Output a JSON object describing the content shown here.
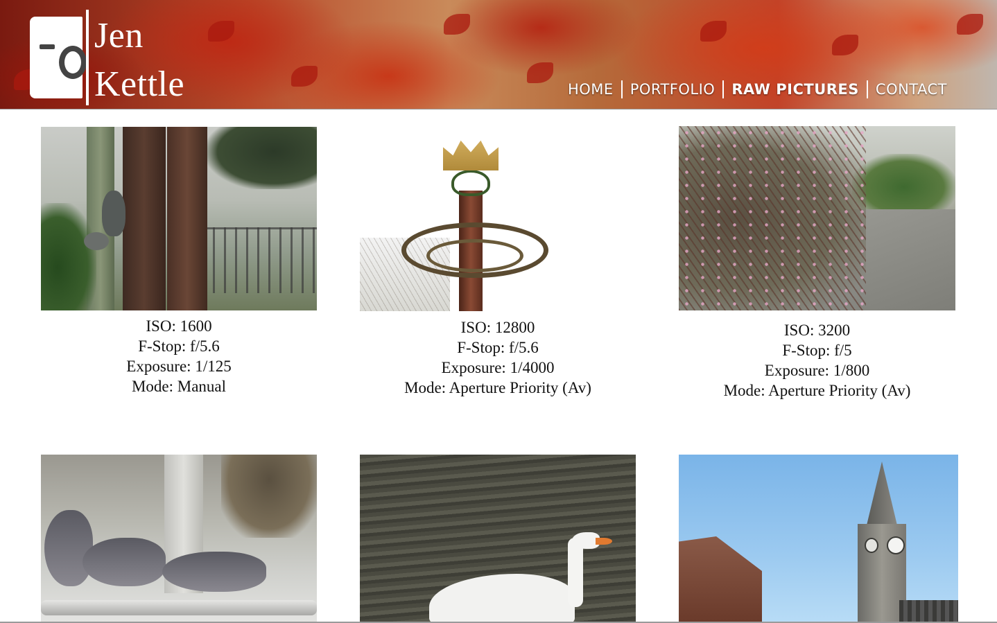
{
  "brand": {
    "first_name": "Jen",
    "last_name": "Kettle",
    "logo_icon": "camera-icon"
  },
  "nav": {
    "items": [
      {
        "label": "HOME",
        "active": false
      },
      {
        "label": "PORTFOLIO",
        "active": false
      },
      {
        "label": "RAW PICTURES",
        "active": true
      },
      {
        "label": "CONTACT",
        "active": false
      }
    ]
  },
  "photos": [
    {
      "subject": "squirrel-photo",
      "iso_label": "ISO",
      "iso": "1600",
      "fstop_label": "F-Stop",
      "fstop": "f/5.6",
      "exposure_label": "Exposure",
      "exposure": "1/125",
      "mode_label": "Mode",
      "mode": "Manual"
    },
    {
      "subject": "crown-photo",
      "iso_label": "ISO",
      "iso": "12800",
      "fstop_label": "F-Stop",
      "fstop": "f/5.6",
      "exposure_label": "Exposure",
      "exposure": "1/4000",
      "mode_label": "Mode",
      "mode": "Aperture Priority (Av)"
    },
    {
      "subject": "blossom-photo",
      "iso_label": "ISO",
      "iso": "3200",
      "fstop_label": "F-Stop",
      "fstop": "f/5",
      "exposure_label": "Exposure",
      "exposure": "1/800",
      "mode_label": "Mode",
      "mode": "Aperture Priority (Av)"
    },
    {
      "subject": "pigeons-photo"
    },
    {
      "subject": "swan-photo"
    },
    {
      "subject": "clock-tower-photo"
    }
  ]
}
